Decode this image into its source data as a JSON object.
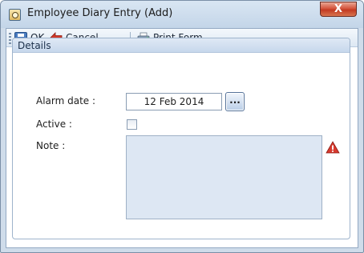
{
  "window": {
    "title": "Employee Diary Entry (Add)",
    "close_glyph": "X"
  },
  "toolbar": {
    "ok_label": "OK",
    "cancel_label": "Cancel",
    "print_label": "Print Form"
  },
  "details": {
    "group_title": "Details",
    "alarm_date_label": "Alarm date :",
    "alarm_date_value": "12 Feb 2014",
    "date_picker_glyph": "...",
    "active_label": "Active :",
    "active_checked": false,
    "note_label": "Note :",
    "note_value": ""
  },
  "icons": {
    "app": "diary-icon",
    "ok": "save-icon",
    "cancel": "back-arrow-icon",
    "print": "printer-icon",
    "note_warning": "warning-icon"
  },
  "colors": {
    "warning": "#d83a2e",
    "note_background": "#dde7f3",
    "close_button": "#c94a33"
  }
}
